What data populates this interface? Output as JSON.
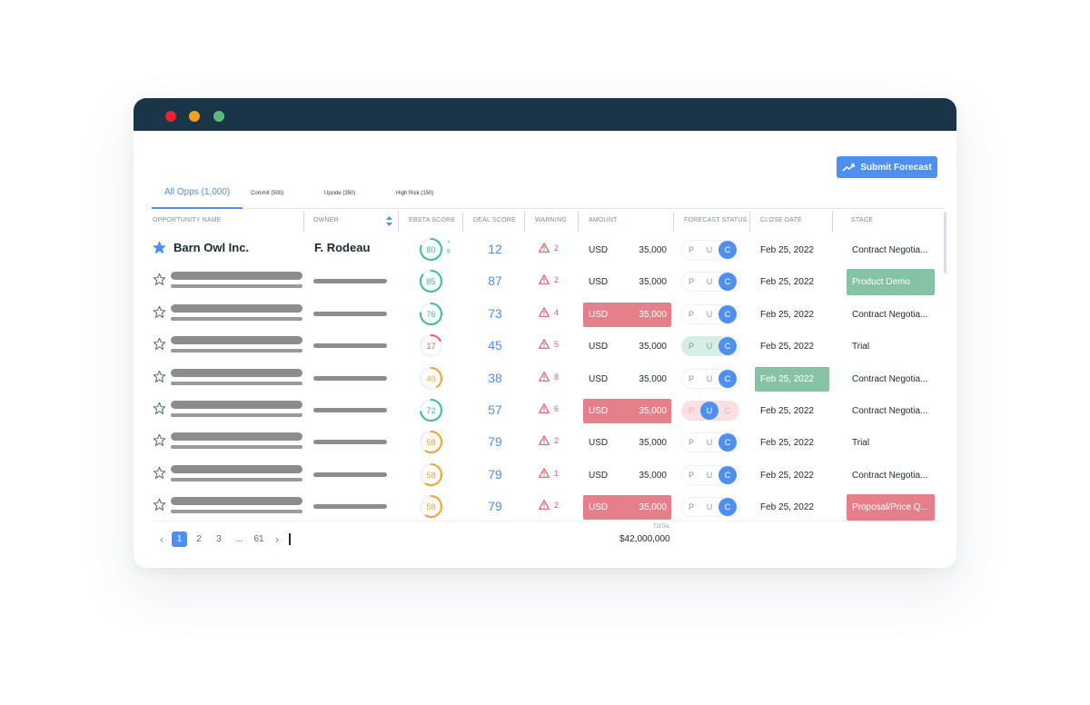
{
  "toolbar": {
    "submit_label": "Submit Forecast"
  },
  "tabs": [
    {
      "label": "All Opps (1,000)"
    },
    {
      "label": "Commit (500)"
    },
    {
      "label": "Upside (350)"
    },
    {
      "label": "High Risk (150)"
    }
  ],
  "columns": [
    "OPPORTUNITY NAME",
    "OWNER",
    "EBSTA SCORE",
    "DEAL SCORE",
    "WARNING",
    "AMOUNT",
    "FORECAST STATUS",
    "CLOSE DATE",
    "STAGE"
  ],
  "rows": [
    {
      "opp": "Barn Owl Inc.",
      "owner": "F. Rodeau",
      "starred": true,
      "ebsta": "80",
      "ebsta_pct": 0.8,
      "ebsta_color": "#3fbf8f",
      "trend": "8",
      "deal": "12",
      "warn": "2",
      "currency": "USD",
      "amount": "35,000",
      "amount_alert": false,
      "fs": "C",
      "fs_style": "",
      "close": "Feb 25, 2022",
      "close_good": false,
      "stage": "Contract Negotia...",
      "stage_color": ""
    },
    {
      "opp": "",
      "owner": "",
      "starred": false,
      "ebsta": "85",
      "ebsta_pct": 0.85,
      "ebsta_color": "#3fbf8f",
      "trend": "",
      "deal": "87",
      "warn": "2",
      "currency": "USD",
      "amount": "35,000",
      "amount_alert": false,
      "fs": "C",
      "fs_style": "",
      "close": "Feb 25, 2022",
      "close_good": false,
      "stage": "Product Demo",
      "stage_color": "green"
    },
    {
      "opp": "",
      "owner": "",
      "starred": false,
      "ebsta": "76",
      "ebsta_pct": 0.76,
      "ebsta_color": "#3fbf8f",
      "trend": "",
      "deal": "73",
      "warn": "4",
      "currency": "USD",
      "amount": "35,000",
      "amount_alert": true,
      "fs": "C",
      "fs_style": "",
      "close": "Feb 25, 2022",
      "close_good": false,
      "stage": "Contract Negotia...",
      "stage_color": ""
    },
    {
      "opp": "",
      "owner": "",
      "starred": false,
      "ebsta": "17",
      "ebsta_pct": 0.17,
      "ebsta_color": "#e35c6a",
      "trend": "",
      "deal": "45",
      "warn": "5",
      "currency": "USD",
      "amount": "35,000",
      "amount_alert": false,
      "fs": "C",
      "fs_style": "upside-shade",
      "close": "Feb 25, 2022",
      "close_good": false,
      "stage": "Trial",
      "stage_color": ""
    },
    {
      "opp": "",
      "owner": "",
      "starred": false,
      "ebsta": "40",
      "ebsta_pct": 0.4,
      "ebsta_color": "#f2a23a",
      "trend": "",
      "deal": "38",
      "warn": "8",
      "currency": "USD",
      "amount": "35,000",
      "amount_alert": false,
      "fs": "C",
      "fs_style": "",
      "close": "Feb 25, 2022",
      "close_good": true,
      "stage": "Contract Negotia...",
      "stage_color": ""
    },
    {
      "opp": "",
      "owner": "",
      "starred": false,
      "ebsta": "72",
      "ebsta_pct": 0.72,
      "ebsta_color": "#3fbf8f",
      "trend": "",
      "deal": "57",
      "warn": "6",
      "currency": "USD",
      "amount": "35,000",
      "amount_alert": true,
      "fs": "U",
      "fs_style": "risk-shade",
      "close": "Feb 25, 2022",
      "close_good": false,
      "stage": "Contract Negotia...",
      "stage_color": ""
    },
    {
      "opp": "",
      "owner": "",
      "starred": false,
      "ebsta": "58",
      "ebsta_pct": 0.58,
      "ebsta_color": "#f2a23a",
      "trend": "",
      "deal": "79",
      "warn": "2",
      "currency": "USD",
      "amount": "35,000",
      "amount_alert": false,
      "fs": "C",
      "fs_style": "",
      "close": "Feb 25, 2022",
      "close_good": false,
      "stage": "Trial",
      "stage_color": ""
    },
    {
      "opp": "",
      "owner": "",
      "starred": false,
      "ebsta": "58",
      "ebsta_pct": 0.58,
      "ebsta_color": "#f2a23a",
      "trend": "",
      "deal": "79",
      "warn": "1",
      "currency": "USD",
      "amount": "35,000",
      "amount_alert": false,
      "fs": "C",
      "fs_style": "",
      "close": "Feb 25, 2022",
      "close_good": false,
      "stage": "Contract Negotia...",
      "stage_color": ""
    },
    {
      "opp": "",
      "owner": "",
      "starred": false,
      "ebsta": "58",
      "ebsta_pct": 0.58,
      "ebsta_color": "#f2a23a",
      "trend": "",
      "deal": "79",
      "warn": "2",
      "currency": "USD",
      "amount": "35,000",
      "amount_alert": true,
      "fs": "C",
      "fs_style": "",
      "close": "Feb 25, 2022",
      "close_good": false,
      "stage": "Proposal/Price Q...",
      "stage_color": "red"
    }
  ],
  "fs_options": [
    "P",
    "U",
    "C"
  ],
  "pagination": {
    "pages": [
      "1",
      "2",
      "3",
      "...",
      "61"
    ],
    "current": "1"
  },
  "footer": {
    "total_label": "TOTAL",
    "total_value": "$42,000,000"
  },
  "colors": {
    "accent": "#4e8ff0",
    "titlebar": "#1b3548",
    "alert_red": "#e3808a",
    "good_green": "#86c3a5"
  }
}
